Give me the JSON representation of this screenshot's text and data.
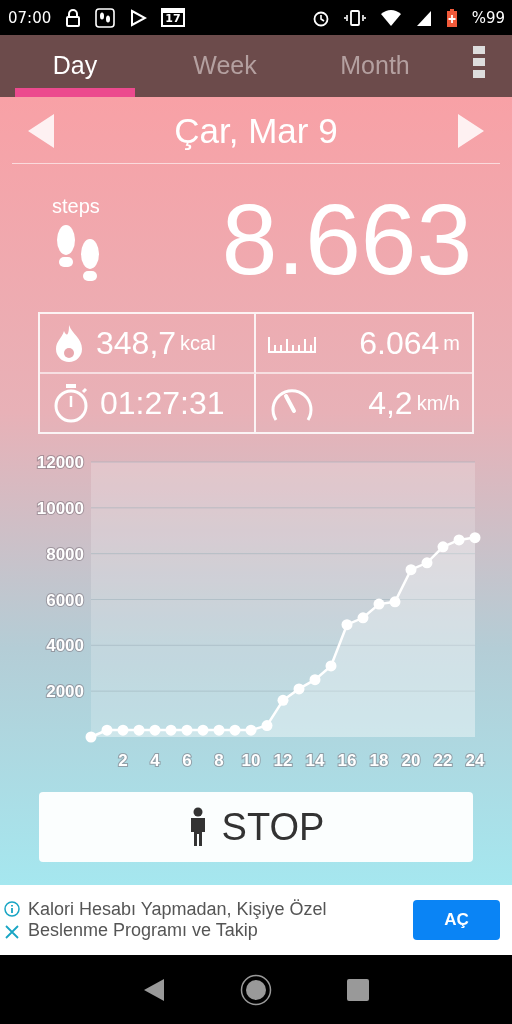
{
  "status_bar": {
    "time": "07:00",
    "calendar_badge": "17",
    "battery": "%99"
  },
  "tabs": [
    {
      "label": "Day",
      "selected": true
    },
    {
      "label": "Week",
      "selected": false
    },
    {
      "label": "Month",
      "selected": false
    }
  ],
  "date": "Çar, Mar 9",
  "steps": {
    "label": "steps",
    "value": "8.663"
  },
  "stats": [
    {
      "kind": "calories",
      "value": "348,7",
      "unit": "kcal"
    },
    {
      "kind": "distance",
      "value": "6.064",
      "unit": "m"
    },
    {
      "kind": "time",
      "value": "01:27:31"
    },
    {
      "kind": "speed",
      "value": "4,2",
      "unit": "km/h"
    }
  ],
  "chart": {
    "chart_data": {
      "type": "area",
      "x": [
        0,
        1,
        2,
        3,
        4,
        5,
        6,
        7,
        8,
        9,
        10,
        11,
        12,
        13,
        14,
        15,
        16,
        17,
        18,
        19,
        20,
        21,
        22,
        23,
        24
      ],
      "series": [
        {
          "color": "#ffffff",
          "values": [
            0,
            300,
            300,
            300,
            300,
            300,
            300,
            300,
            300,
            300,
            300,
            500,
            1600,
            2100,
            2500,
            3100,
            4900,
            5200,
            5800,
            5900,
            7300,
            7600,
            8300,
            8600,
            8700
          ]
        }
      ],
      "grid": true,
      "xlim": [
        0,
        24
      ],
      "ylim": [
        0,
        12000
      ],
      "xticks": [
        2,
        4,
        6,
        8,
        10,
        12,
        14,
        16,
        18,
        20,
        22,
        24
      ],
      "yticks": [
        2000,
        4000,
        6000,
        8000,
        10000,
        12000
      ]
    }
  },
  "stop_button": "STOP",
  "ad": {
    "text": "Kalori Hesabı Yapmadan, Kişiye Özel Beslenme Programı ve Takip",
    "button": "AÇ"
  }
}
